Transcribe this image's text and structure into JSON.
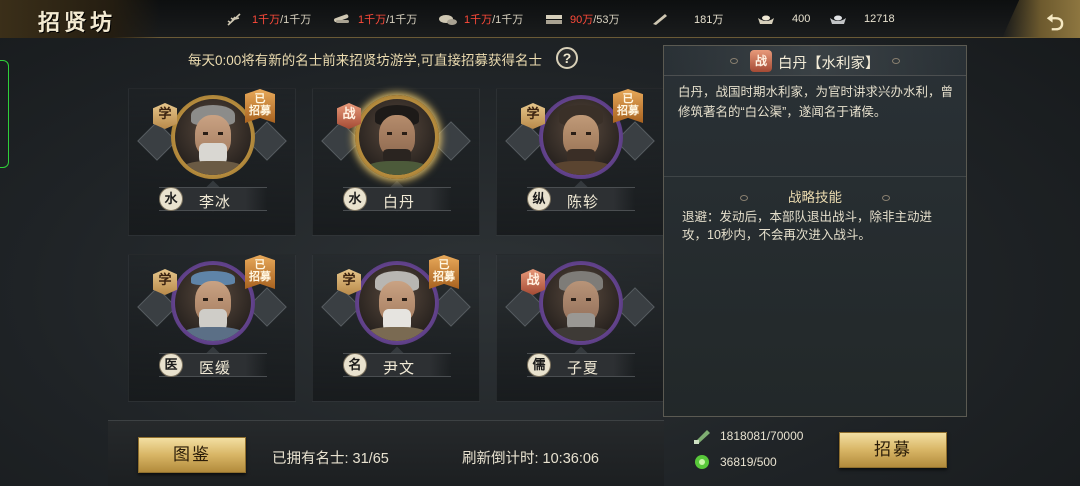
{
  "header": {
    "title": "招贤坊",
    "resources": [
      {
        "icon": "grain-icon",
        "current": "1千万",
        "max": "/1千万",
        "current_red": true
      },
      {
        "icon": "wood-icon",
        "current": "1千万",
        "max": "/1千万",
        "current_red": true
      },
      {
        "icon": "stone-icon",
        "current": "1千万",
        "max": "/1千万",
        "current_red": true
      },
      {
        "icon": "iron-icon",
        "current": "90万",
        "max": "/53万",
        "current_red": true
      },
      {
        "icon": "decree-icon",
        "current": "181万",
        "max": "",
        "current_red": false
      },
      {
        "icon": "gold-ingot-icon",
        "current": "400",
        "max": "",
        "current_red": false
      },
      {
        "icon": "silver-ingot-icon",
        "current": "12718",
        "max": "",
        "current_red": false
      }
    ]
  },
  "notice": {
    "text": "每天0:00将有新的名士前来招贤坊游学,可直接招募获得名士",
    "help_label": "?"
  },
  "heroes": [
    {
      "name": "李冰",
      "class": "学",
      "class_type": "study",
      "tag": "水",
      "recruited": true,
      "recruited_label": "已\n招募",
      "ring": "gold",
      "selected": false
    },
    {
      "name": "白丹",
      "class": "战",
      "class_type": "war",
      "tag": "水",
      "recruited": false,
      "recruited_label": "",
      "ring": "gold",
      "selected": true
    },
    {
      "name": "陈轸",
      "class": "学",
      "class_type": "study",
      "tag": "纵",
      "recruited": true,
      "recruited_label": "已\n招募",
      "ring": "purple",
      "selected": false
    },
    {
      "name": "医缓",
      "class": "学",
      "class_type": "study",
      "tag": "医",
      "recruited": true,
      "recruited_label": "已\n招募",
      "ring": "purple",
      "selected": false
    },
    {
      "name": "尹文",
      "class": "学",
      "class_type": "study",
      "tag": "名",
      "recruited": true,
      "recruited_label": "已\n招募",
      "ring": "purple",
      "selected": false
    },
    {
      "name": "子夏",
      "class": "战",
      "class_type": "war",
      "tag": "儒",
      "recruited": false,
      "recruited_label": "",
      "ring": "purple",
      "selected": false
    }
  ],
  "detail": {
    "badge": "战",
    "title": "白丹【水利家】",
    "bio": "白丹，战国时期水利家，为官时讲求兴办水利，曾修筑著名的“白公渠”，遂闻名于诸侯。",
    "skill_title": "战略技能",
    "skill_desc": "退避：发动后，本部队退出战斗，除非主动进攻，10秒内，不会再次进入战斗。"
  },
  "footer": {
    "catalog_label": "图鉴",
    "owned_label": "已拥有名士: 31/65",
    "refresh_label": "刷新倒计时: 10:36:06",
    "cost_1": "1818081/70000",
    "cost_2": "36819/500",
    "recruit_label": "招募"
  }
}
